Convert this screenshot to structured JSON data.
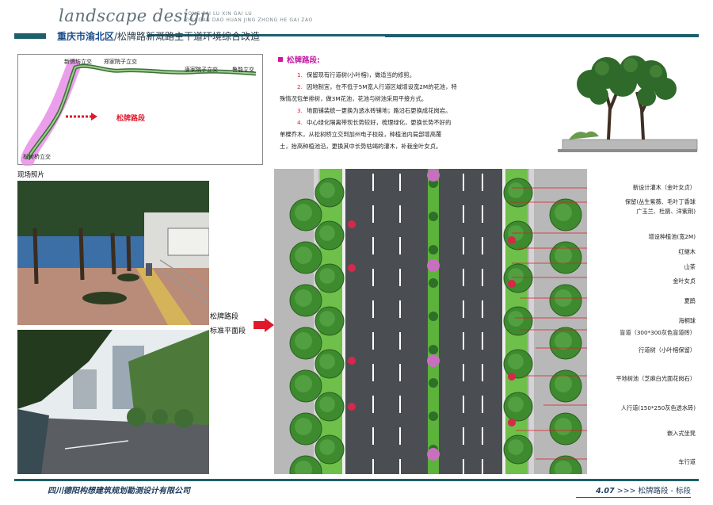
{
  "header": {
    "brand": "landscape design",
    "brand_sub_line1": "SONG PAI LU  XIN GAI LU",
    "brand_sub_line2": "ZHU GAN DAO HUAN JING ZHONG HE GAI ZAO",
    "district": "重庆市渝北区",
    "project": "/松牌路新溉路主干道环境综合改造"
  },
  "map": {
    "labels": [
      "新牌坊立交",
      "郑家院子立交",
      "唐家院子立交",
      "鲁能立交",
      "松树桥立交"
    ],
    "arrow_label": "松牌路段"
  },
  "description": {
    "heading": "松牌路段:",
    "items": [
      {
        "num": "1.",
        "text": "保留现有行道树(小叶榕)，做适当的修剪。"
      },
      {
        "num": "2.",
        "text": "因地制宜，在不低于5M宽人行道区域增设宽2M的花池，特"
      },
      {
        "num": "",
        "text": "殊情况包单排树，做3M花池，花池与树池采用平接方式。"
      },
      {
        "num": "3.",
        "text": "地面铺装统一更换为透水砖铺地；路沿石更换成花岗岩。"
      },
      {
        "num": "4.",
        "text": "中心绿化隔离带现长势较好，梳理绿化，更换长势不好的"
      },
      {
        "num": "",
        "text": "单棵乔木，从松树桥立交到加州电子校段，种植池内局部增高覆"
      },
      {
        "num": "",
        "text": "土，抬高种植池沿，更换其中长势枯竭的灌木，补栽金叶女贞。"
      }
    ]
  },
  "photos": {
    "label": "现场照片"
  },
  "section": {
    "line1": "松牌路段",
    "line2": "标准平面段"
  },
  "legend": [
    "新设计灌木（金叶女贞）",
    "保留(丛生紫薇、毛叶丁香球",
    "广玉兰、杜鹃、洋紫荆)",
    "增设种植池(宽2M)",
    "红継木",
    "山茶",
    "金叶女贞",
    "夏鹃",
    "海桐球",
    "盲道（300*300灰色盲道砖）",
    "行道树（小叶榕保留）",
    "平地树池（芝麻白光面花岗石）",
    "人行道(150*250灰色透水砖)",
    "嵌入式坐凳",
    "车行道"
  ],
  "footer": {
    "company": "四川德阳构想建筑规划勘测设计有限公司",
    "page_number": "4.07",
    "page_title": ">>> 松牌路段 - 标段"
  },
  "colors": {
    "accent_teal": "#1d5f6b",
    "title_blue": "#1d4f8a",
    "highlight_magenta": "#d4159b",
    "leader_red": "#e0182a",
    "road": "#4a4e52",
    "green_strip": "#5cb33b",
    "paving": "#b8b8b8"
  }
}
